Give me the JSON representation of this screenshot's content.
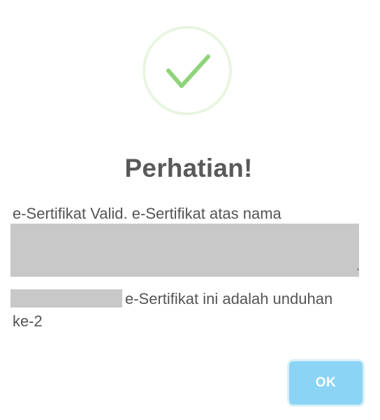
{
  "dialog": {
    "icon": "check-circle-icon",
    "title": "Perhatian!",
    "message": {
      "line1": "e-Sertifikat Valid. e-Sertifikat atas nama",
      "line3": "e-Sertifikat ini adalah unduhan",
      "line4": "ke-2"
    },
    "ok_label": "OK"
  },
  "colors": {
    "success_check": "#8fd37a",
    "success_ring": "#e8f5e0",
    "title": "#595959",
    "text": "#545454",
    "redaction": "#c8c8c8",
    "button": "#8cd4f5"
  }
}
